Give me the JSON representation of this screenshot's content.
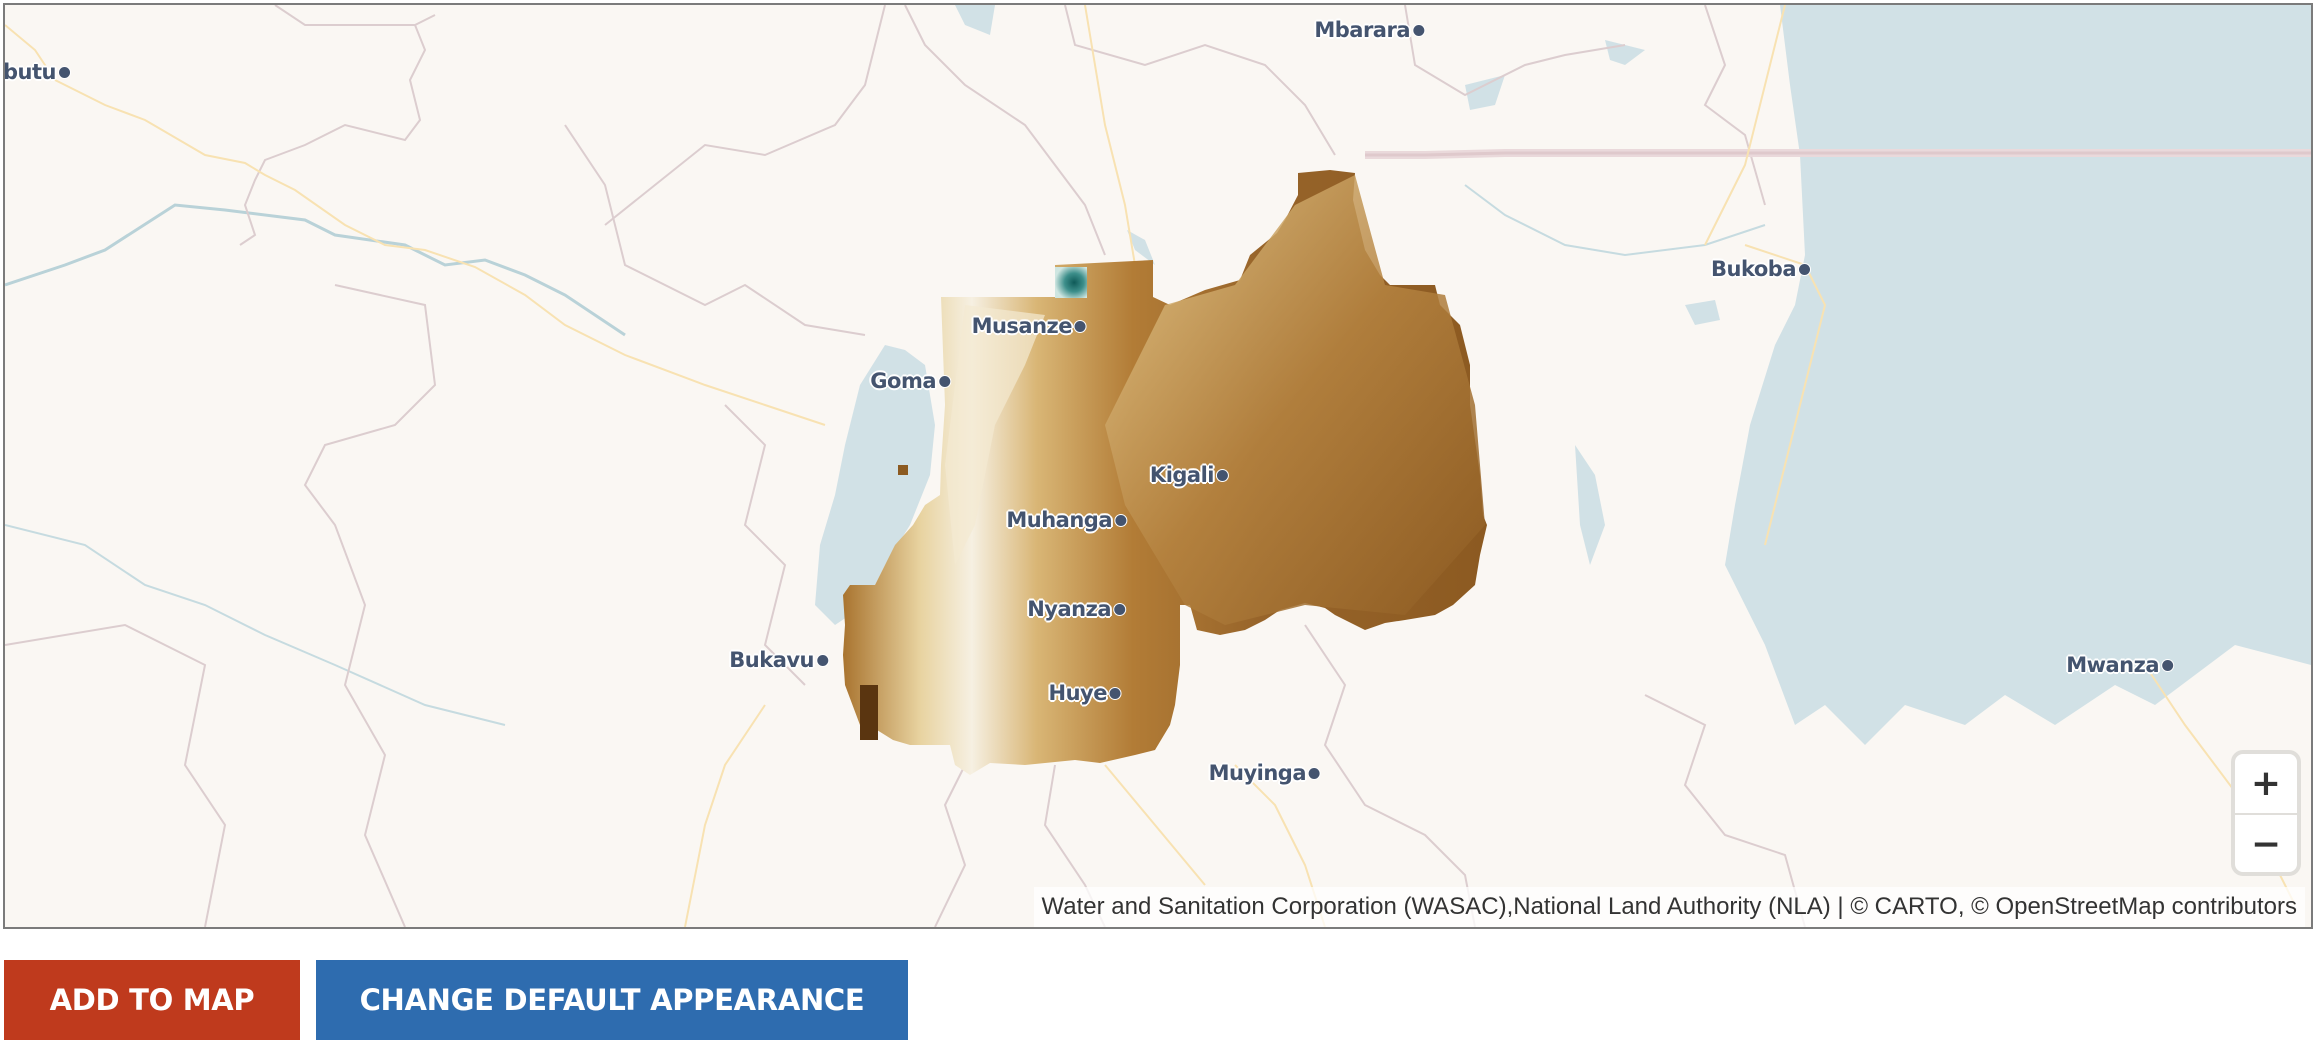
{
  "map": {
    "colors": {
      "land": "#faf7f3",
      "water": "#d1e1e6",
      "boundary": "#dccdcf",
      "road": "#f8e2b2",
      "label": "#44546f",
      "elevation_low": "#f7efdc",
      "elevation_high": "#8c5a21",
      "elevation_peak": "#2f7f7d"
    },
    "cities": [
      {
        "name": "butu"
      },
      {
        "name": "Mbarara"
      },
      {
        "name": "Bukoba"
      },
      {
        "name": "Musanze"
      },
      {
        "name": "Goma"
      },
      {
        "name": "Kigali"
      },
      {
        "name": "Muhanga"
      },
      {
        "name": "Nyanza"
      },
      {
        "name": "Bukavu"
      },
      {
        "name": "Huye"
      },
      {
        "name": "Muyinga"
      },
      {
        "name": "Mwanza"
      }
    ],
    "zoom_in_label": "+",
    "zoom_out_label": "−",
    "attribution": "Water and Sanitation Corporation (WASAC),National Land Authority (NLA) | © CARTO, © OpenStreetMap contributors"
  },
  "actions": {
    "add_to_map": "ADD TO MAP",
    "change_default_appearance": "CHANGE DEFAULT APPEARANCE"
  }
}
